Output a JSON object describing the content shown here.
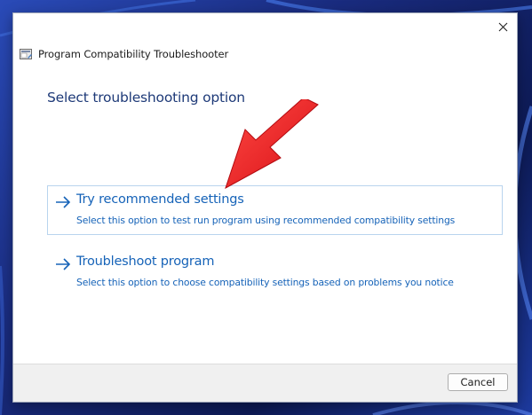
{
  "window": {
    "title": "Program Compatibility Troubleshooter",
    "close_icon": "close-icon",
    "app_icon": "troubleshooter-app-icon"
  },
  "main": {
    "heading": "Select troubleshooting option",
    "options": [
      {
        "title": "Try recommended settings",
        "description": "Select this option to test run program using recommended compatibility settings",
        "icon": "arrow-right-icon",
        "selected": true
      },
      {
        "title": "Troubleshoot program",
        "description": "Select this option to choose compatibility settings based on problems you notice",
        "icon": "arrow-right-icon",
        "selected": false
      }
    ]
  },
  "footer": {
    "cancel_label": "Cancel"
  },
  "colors": {
    "link_blue": "#1663b8",
    "heading_blue": "#1e3a78",
    "selection_border": "#b9d4ee",
    "annotation_red": "#e8141b"
  }
}
